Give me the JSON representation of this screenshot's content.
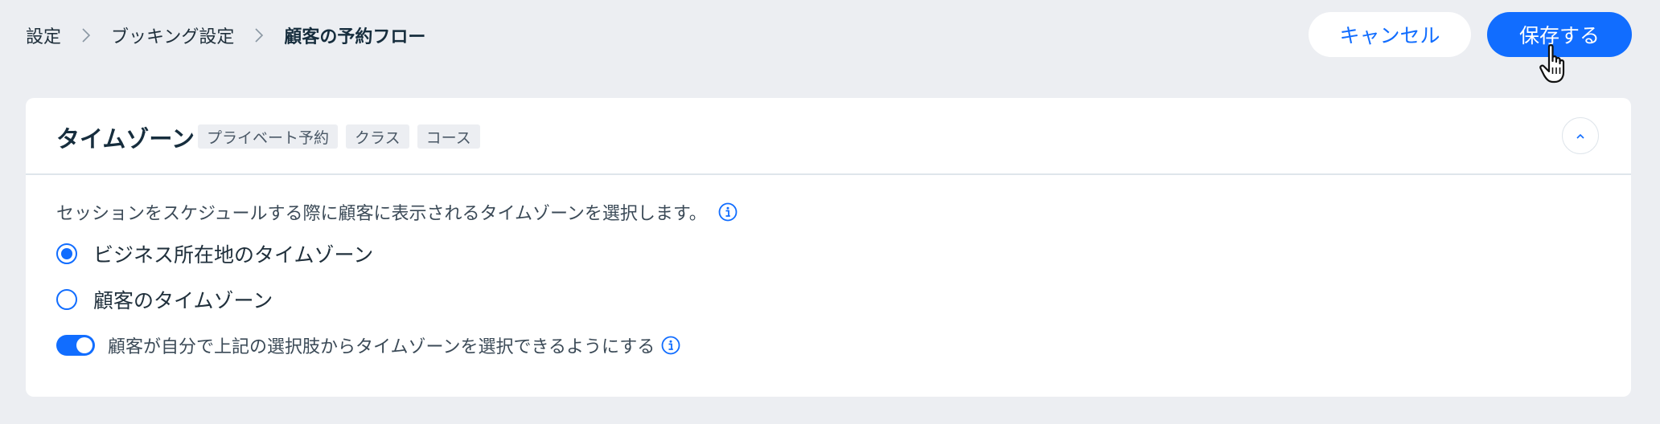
{
  "breadcrumb": {
    "items": [
      "設定",
      "ブッキング設定",
      "顧客の予約フロー"
    ]
  },
  "actions": {
    "cancel_label": "キャンセル",
    "save_label": "保存する"
  },
  "section": {
    "title": "タイムゾーン",
    "tags": [
      "プライベート予約",
      "クラス",
      "コース"
    ],
    "description": "セッションをスケジュールする際に顧客に表示されるタイムゾーンを選択します。",
    "options": [
      {
        "label": "ビジネス所在地のタイムゾーン",
        "selected": true
      },
      {
        "label": "顧客のタイムゾーン",
        "selected": false
      }
    ],
    "toggle": {
      "label": "顧客が自分で上記の選択肢からタイムゾーンを選択できるようにする",
      "on": true
    }
  },
  "colors": {
    "accent": "#116dff",
    "background": "#eceef2",
    "card": "#ffffff",
    "text": "#20303c"
  },
  "icons": {
    "breadcrumb_separator": "chevron-right-icon",
    "info": "info-icon",
    "collapse": "chevron-up-icon",
    "cursor": "hand-pointer-icon"
  }
}
